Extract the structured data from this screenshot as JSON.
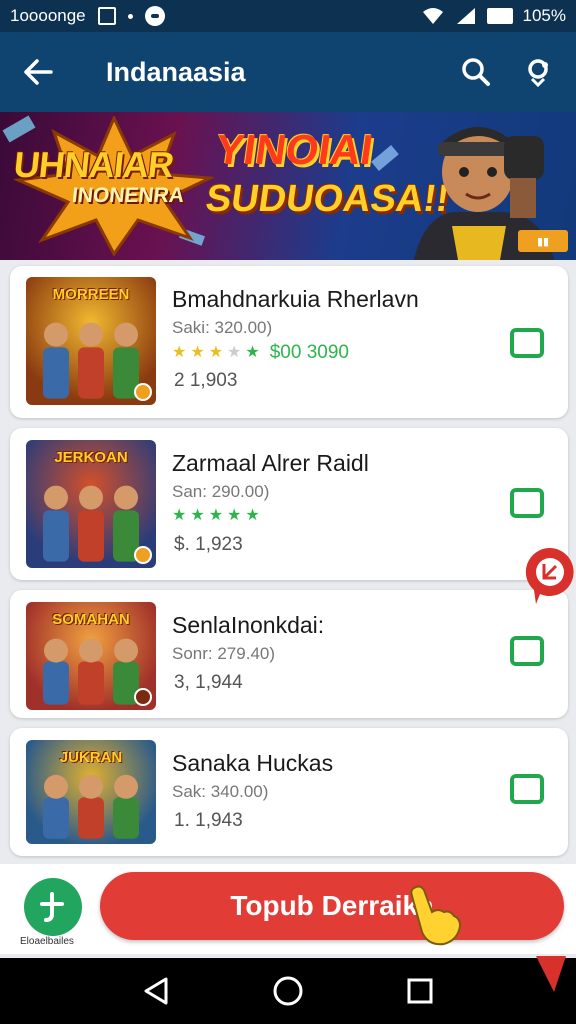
{
  "status_bar": {
    "left_text": "1oooonge",
    "battery": "105%"
  },
  "app_bar": {
    "title": "Indanaasia"
  },
  "banner": {
    "brand_line1": "UHNAIAR",
    "brand_line2": "INONENRA",
    "headline1": "YINOIAI",
    "headline2": "SUDUOASA!!"
  },
  "apps": [
    {
      "name": "Bmahdnarkuia Rherlavn",
      "sub": "Saki: 320.00)",
      "rating": 3,
      "price": "$00 3090",
      "downloads": "2 1,903",
      "thumb_text": "MORREEN",
      "thumb_colors": [
        "#8a3a10",
        "#f0b830"
      ]
    },
    {
      "name": "Zarmaal Alrer Raidl",
      "sub": "San: 290.00)",
      "rating": 5,
      "price": "",
      "downloads": "$. 1,923",
      "thumb_text": "JERKOAN",
      "thumb_colors": [
        "#2a3c7a",
        "#d2502a"
      ]
    },
    {
      "name": "SenlaInonkdai:",
      "sub": "Sonr: 279.40)",
      "rating": 0,
      "price": "",
      "downloads": "3, 1,944",
      "thumb_text": "SOMAHAN",
      "thumb_colors": [
        "#a0302a",
        "#f0a040"
      ]
    },
    {
      "name": "Sanaka Huckas",
      "sub": "Sak: 340.00)",
      "rating": 0,
      "price": "",
      "downloads": "1. 1,943",
      "thumb_text": "JUKRAN",
      "thumb_colors": [
        "#2a5a8a",
        "#e0b030"
      ]
    }
  ],
  "cta": {
    "label": "Topub Derraika",
    "mini_app_label": "Eloaelbailes"
  },
  "colors": {
    "app_bar": "#0f4470",
    "status_bar": "#0d3150",
    "accent_green": "#21a84d",
    "cta_red": "#e23c36"
  },
  "icons": {
    "back": "arrow-left-icon",
    "search": "search-icon",
    "share": "share-icon",
    "action": "square-outline-icon",
    "nav_back": "triangle-back-icon",
    "nav_home": "circle-home-icon",
    "nav_recents": "square-recents-icon"
  }
}
